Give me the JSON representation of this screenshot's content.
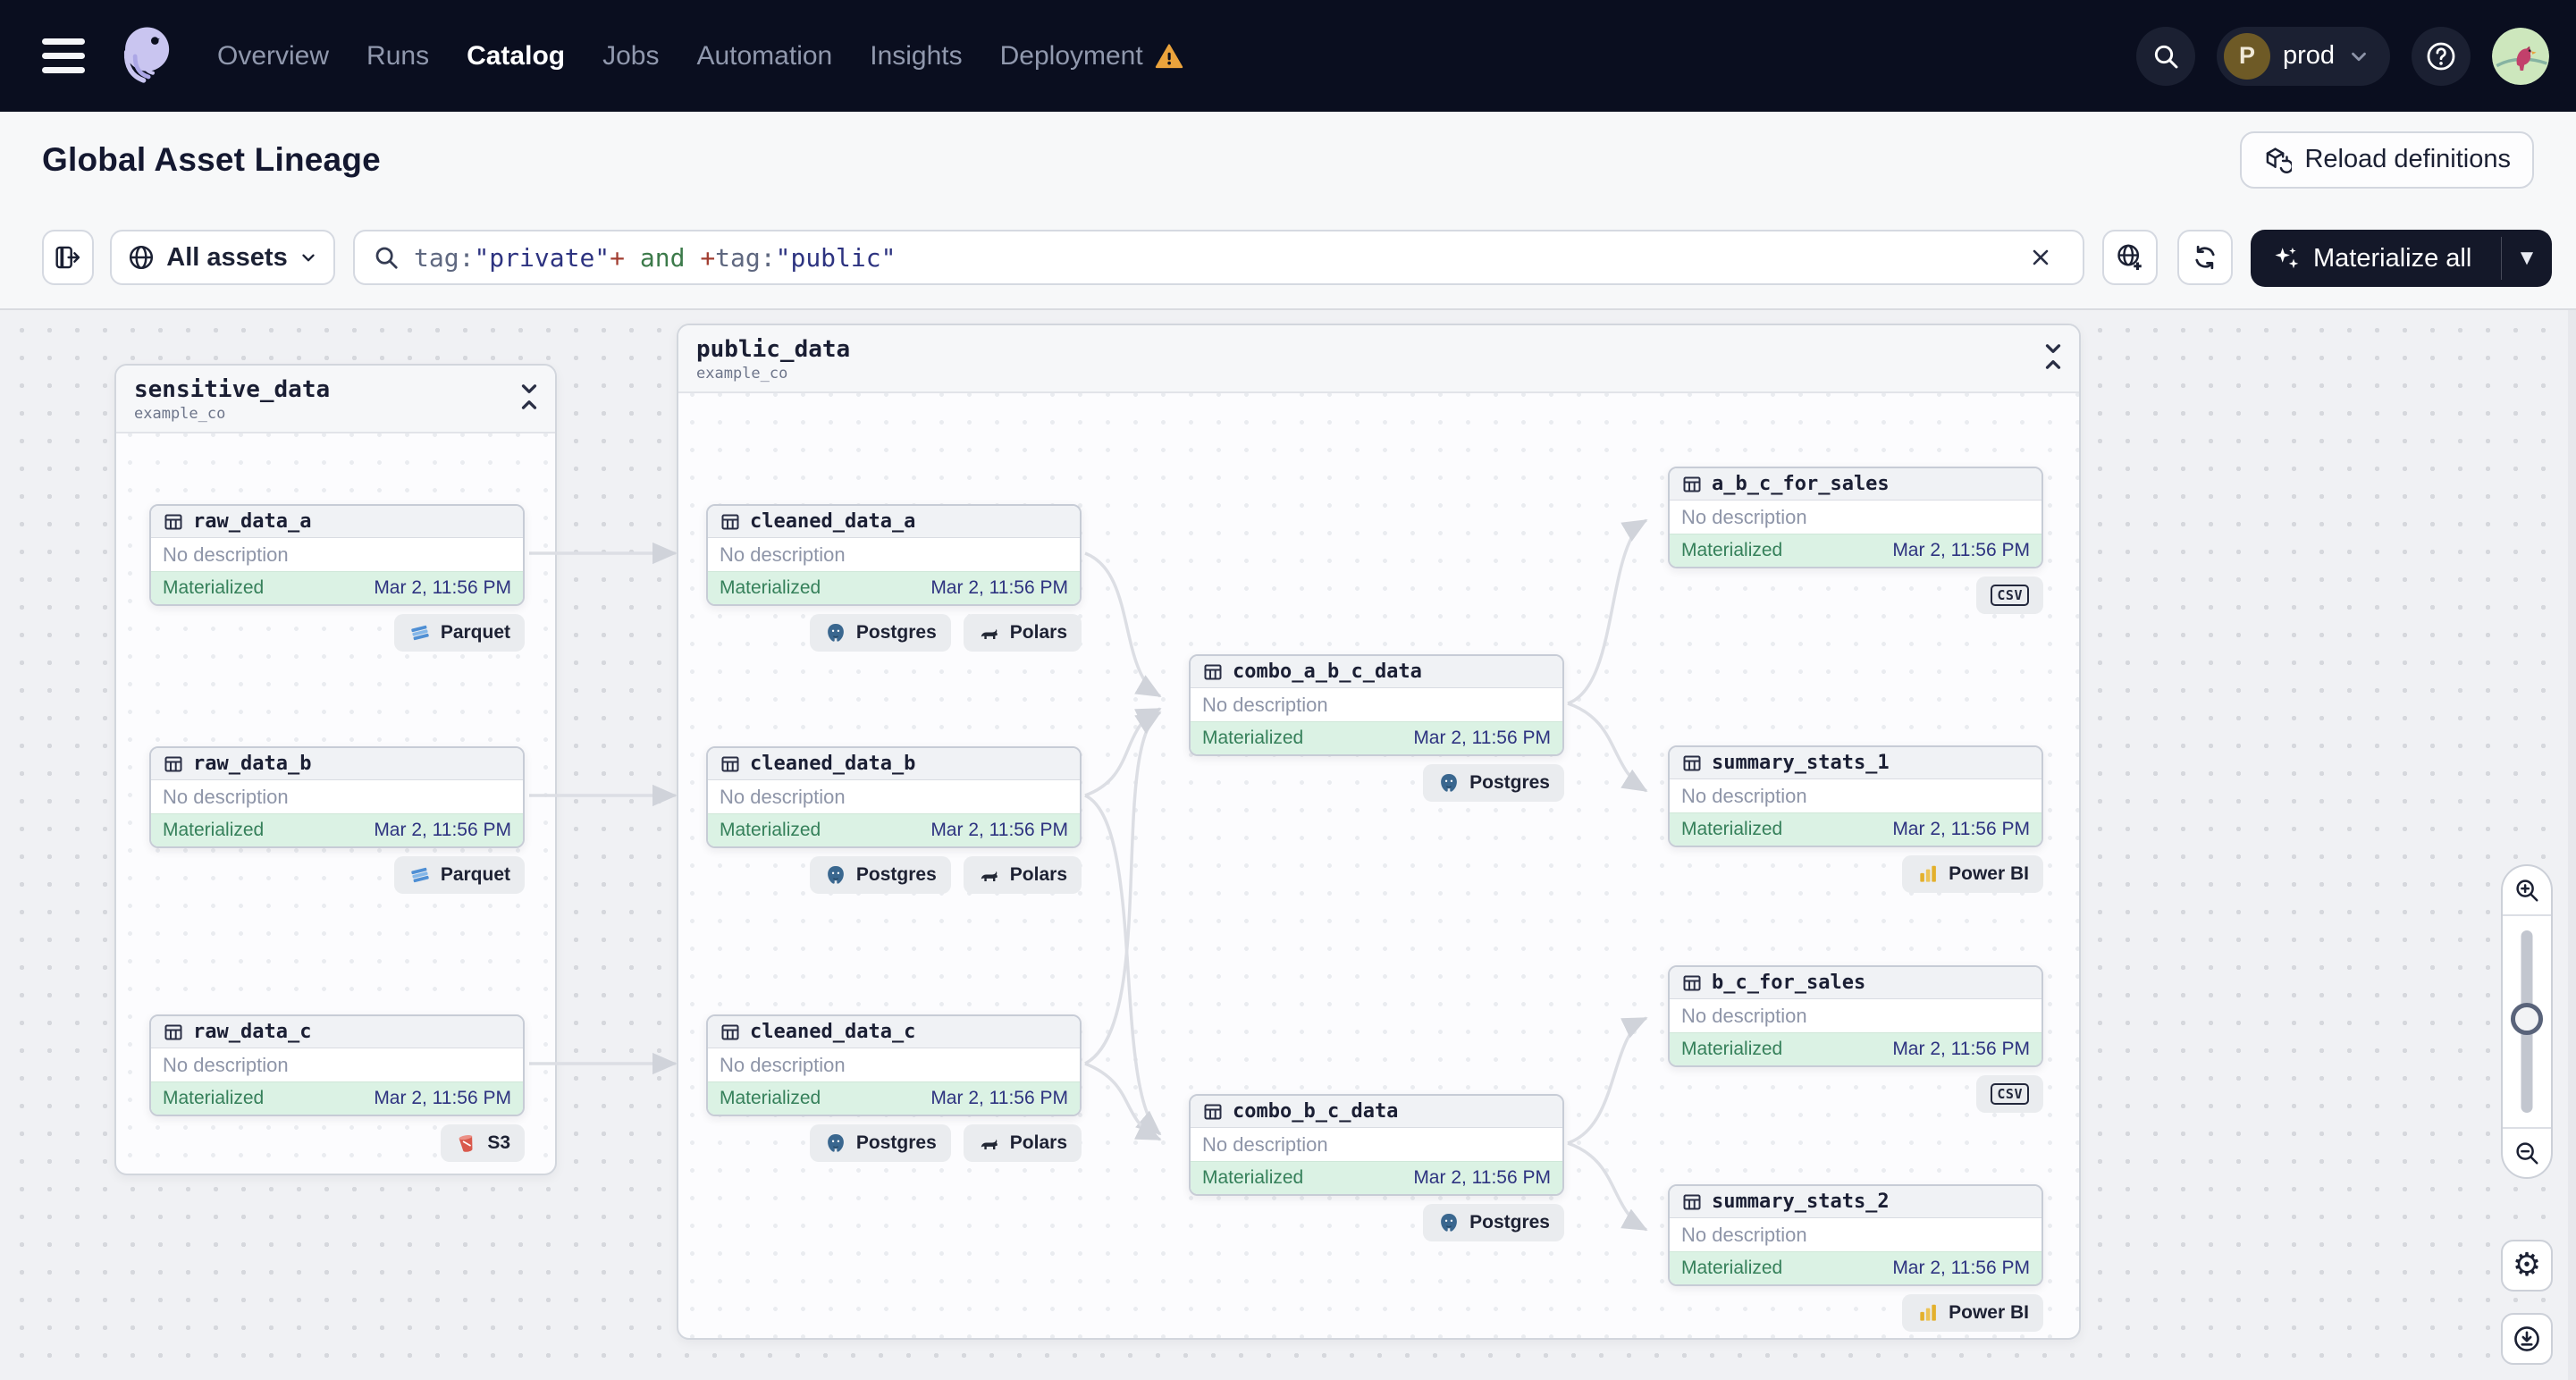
{
  "nav": {
    "items": [
      {
        "label": "Overview"
      },
      {
        "label": "Runs"
      },
      {
        "label": "Catalog",
        "active": true
      },
      {
        "label": "Jobs"
      },
      {
        "label": "Automation"
      },
      {
        "label": "Insights"
      },
      {
        "label": "Deployment",
        "warning": true
      }
    ],
    "environment": {
      "initial": "P",
      "name": "prod"
    }
  },
  "header": {
    "title": "Global Asset Lineage",
    "reload_label": "Reload definitions"
  },
  "toolbar": {
    "scope_label": "All assets",
    "search": {
      "segments": [
        {
          "text": "tag:"
        },
        {
          "text": "\"private\""
        },
        {
          "text": "+"
        },
        {
          "text": " and "
        },
        {
          "text": "+"
        },
        {
          "text": "tag:"
        },
        {
          "text": "\"public\""
        }
      ]
    },
    "materialize_label": "Materialize all"
  },
  "graph": {
    "groups": [
      {
        "name": "sensitive_data",
        "subtitle": "example_co"
      },
      {
        "name": "public_data",
        "subtitle": "example_co"
      }
    ],
    "nodes": [
      {
        "name": "raw_data_a",
        "description": "No description",
        "status": "Materialized",
        "timestamp": "Mar 2, 11:56 PM",
        "tags": [
          {
            "icon": "parquet-icon",
            "label": "Parquet"
          }
        ]
      },
      {
        "name": "raw_data_b",
        "description": "No description",
        "status": "Materialized",
        "timestamp": "Mar 2, 11:56 PM",
        "tags": [
          {
            "icon": "parquet-icon",
            "label": "Parquet"
          }
        ]
      },
      {
        "name": "raw_data_c",
        "description": "No description",
        "status": "Materialized",
        "timestamp": "Mar 2, 11:56 PM",
        "tags": [
          {
            "icon": "s3-icon",
            "label": "S3"
          }
        ]
      },
      {
        "name": "cleaned_data_a",
        "description": "No description",
        "status": "Materialized",
        "timestamp": "Mar 2, 11:56 PM",
        "tags": [
          {
            "icon": "postgres-icon",
            "label": "Postgres"
          },
          {
            "icon": "polars-icon",
            "label": "Polars"
          }
        ]
      },
      {
        "name": "cleaned_data_b",
        "description": "No description",
        "status": "Materialized",
        "timestamp": "Mar 2, 11:56 PM",
        "tags": [
          {
            "icon": "postgres-icon",
            "label": "Postgres"
          },
          {
            "icon": "polars-icon",
            "label": "Polars"
          }
        ]
      },
      {
        "name": "cleaned_data_c",
        "description": "No description",
        "status": "Materialized",
        "timestamp": "Mar 2, 11:56 PM",
        "tags": [
          {
            "icon": "postgres-icon",
            "label": "Postgres"
          },
          {
            "icon": "polars-icon",
            "label": "Polars"
          }
        ]
      },
      {
        "name": "combo_a_b_c_data",
        "description": "No description",
        "status": "Materialized",
        "timestamp": "Mar 2, 11:56 PM",
        "tags": [
          {
            "icon": "postgres-icon",
            "label": "Postgres"
          }
        ]
      },
      {
        "name": "combo_b_c_data",
        "description": "No description",
        "status": "Materialized",
        "timestamp": "Mar 2, 11:56 PM",
        "tags": [
          {
            "icon": "postgres-icon",
            "label": "Postgres"
          }
        ]
      },
      {
        "name": "a_b_c_for_sales",
        "description": "No description",
        "status": "Materialized",
        "timestamp": "Mar 2, 11:56 PM",
        "tags": [
          {
            "icon": "csv-icon",
            "label": "CSV"
          }
        ]
      },
      {
        "name": "summary_stats_1",
        "description": "No description",
        "status": "Materialized",
        "timestamp": "Mar 2, 11:56 PM",
        "tags": [
          {
            "icon": "powerbi-icon",
            "label": "Power BI"
          }
        ]
      },
      {
        "name": "b_c_for_sales",
        "description": "No description",
        "status": "Materialized",
        "timestamp": "Mar 2, 11:56 PM",
        "tags": [
          {
            "icon": "csv-icon",
            "label": "CSV"
          }
        ]
      },
      {
        "name": "summary_stats_2",
        "description": "No description",
        "status": "Materialized",
        "timestamp": "Mar 2, 11:56 PM",
        "tags": [
          {
            "icon": "powerbi-icon",
            "label": "Power BI"
          }
        ]
      }
    ]
  },
  "colors": {
    "nav_bg": "#0a0e1f",
    "materialize_button": "#141829",
    "warning": "#eba33c",
    "materialized_green": "#35805a",
    "timestamp_navy": "#2e3380",
    "query_key": "#5f6880",
    "query_string": "#2d3380",
    "query_plus": "#a13d30",
    "query_and": "#3c7a4a",
    "edge": "#dcdee4",
    "footer_green_bg": "#dbf2e4"
  }
}
